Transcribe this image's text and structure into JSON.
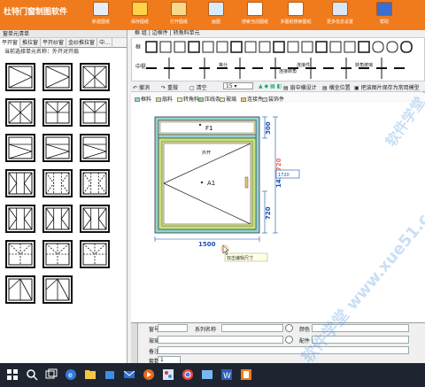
{
  "app": {
    "title": "杜特门窗制图软件"
  },
  "toolbar": {
    "items": [
      {
        "label": "新建图纸",
        "icon": "new-doc-icon",
        "color": "#e8eef8"
      },
      {
        "label": "保存图纸",
        "icon": "save-icon",
        "color": "#ffd24a"
      },
      {
        "label": "打开图纸",
        "icon": "open-folder-icon",
        "color": "#f8d98a"
      },
      {
        "label": "画图",
        "icon": "draw-icon",
        "color": "#d8ecff"
      },
      {
        "label": "搜索当前图纸",
        "icon": "search-current-icon",
        "color": "#ffffff"
      },
      {
        "label": "多图纸搜索图纸",
        "icon": "multi-search-icon",
        "color": "#ffffff"
      },
      {
        "label": "更多信息设置",
        "icon": "settings-icon",
        "color": "#dbe6f5"
      },
      {
        "label": "帮助",
        "icon": "help-book-icon",
        "color": "#3a6fd0"
      }
    ]
  },
  "left": {
    "header": "窗单元清单",
    "tabs": [
      "平开窗",
      "推拉窗",
      "平开纱窗",
      "金纱推拉窗",
      "中…"
    ],
    "subtitle": "当前选择单元名称：外开对开扇"
  },
  "right": {
    "label": "框 组 | 边框件 | 转角料单元"
  },
  "shape_rows": {
    "frame_label": "框",
    "mullion_label": "中梃",
    "equal_label": "等分",
    "connector_label": "连接件",
    "corner_label": "连接转角",
    "glass_label": "转角玻璃"
  },
  "ops": {
    "undo": "撤消",
    "redo": "重做",
    "clear": "清空",
    "size_value": "15",
    "outer_design": "扇中横设计",
    "lock_position": "横坐位置",
    "save_template": "把该图片保存为常用模型"
  },
  "legend": [
    {
      "label": "框料",
      "color": "#8fd3d8"
    },
    {
      "label": "扇料",
      "color": "#c6e27a"
    },
    {
      "label": "转角料",
      "color": "#f3f3a5"
    },
    {
      "label": "压线条",
      "color": "#8fd38f"
    },
    {
      "label": "玻璃",
      "color": "#f5e6a0"
    },
    {
      "label": "连接件",
      "color": "#f0c074"
    },
    {
      "label": "装饰件",
      "color": "#dddddd"
    }
  ],
  "drawing": {
    "fixed_label": "F1",
    "sash_label": "A1",
    "open_label": "外开",
    "dim_top": "300",
    "dim_total_height": "1420",
    "dim_total_height_overlay": "1720",
    "dim_sash_low": "720",
    "dim_width": "1500",
    "tooltip": "双击编辑尺寸",
    "edit_box": "1720",
    "frame_color": "#8fd3d8",
    "sash_color": "#c6e27a",
    "dim_color": "#1a4fb5",
    "dim_overlay_color": "#e05a3a"
  },
  "form": {
    "window_no": "窗号",
    "series_name": "系列名称",
    "color": "颜色",
    "glass": "玻璃",
    "accessory": "配件",
    "note": "备注",
    "qty": "套数",
    "qty_value": "1"
  },
  "watermark": "软件学堂 www.xue51.com"
}
